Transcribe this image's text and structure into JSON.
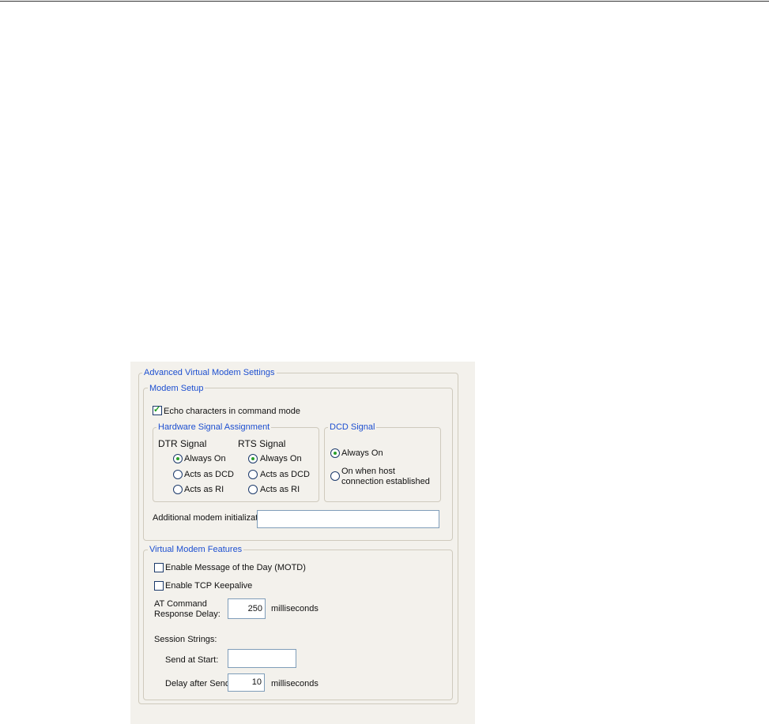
{
  "title": "Advanced Virtual Modem Settings",
  "modem_setup": {
    "title": "Modem Setup",
    "echo_label": "Echo characters in command mode",
    "echo_checked": true,
    "hw": {
      "title": "Hardware Signal Assignment",
      "dtr_label": "DTR Signal",
      "rts_label": "RTS Signal",
      "options": [
        "Always On",
        "Acts as DCD",
        "Acts as RI"
      ],
      "dtr_selected": 0,
      "rts_selected": 0
    },
    "dcd": {
      "title": "DCD Signal",
      "options": [
        "Always On",
        "On when host connection established"
      ],
      "selected": 0
    },
    "init_label": "Additional modem initialization:",
    "init_value": ""
  },
  "features": {
    "title": "Virtual Modem Features",
    "motd_label": "Enable Message of the Day (MOTD)",
    "motd_checked": false,
    "keepalive_label": "Enable TCP Keepalive",
    "keepalive_checked": false,
    "at_label_1": "AT Command",
    "at_label_2": "Response Delay:",
    "at_value": "250",
    "unit": "milliseconds",
    "session_label": "Session Strings:",
    "send_start_label": "Send at Start:",
    "send_start_value": "",
    "delay_label": "Delay after Send:",
    "delay_value": "10"
  }
}
